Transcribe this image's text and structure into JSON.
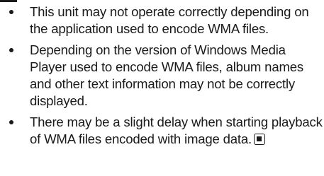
{
  "notes": [
    {
      "text": "This unit may not operate correctly depending on the application used to encode WMA files."
    },
    {
      "text": "Depending on the version of Windows Media Player used to encode WMA files, album names and other text information may not be correctly displayed."
    },
    {
      "text": "There may be a slight delay when starting playback of WMA files encoded with image data."
    }
  ],
  "icons": {
    "bullet": "bullet-icon",
    "end": "end-of-section-icon"
  }
}
